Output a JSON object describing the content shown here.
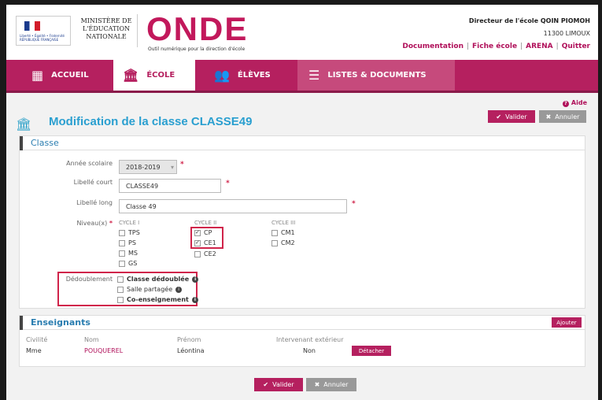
{
  "header": {
    "marianne_text": "Liberté • Égalité • Fraternité RÉPUBLIQUE FRANÇAISE",
    "ministere": "MINISTÈRE DE L'ÉDUCATION NATIONALE",
    "app_name": "ONDE",
    "app_subtitle": "Outil numérique pour la direction d'école",
    "user_name": "Directeur de l'école QOIN PIOMOH",
    "user_ecole": "11300 LIMOUX",
    "links": [
      "Documentation",
      "Fiche école",
      "ARENA",
      "Quitter"
    ]
  },
  "nav": {
    "items": [
      {
        "label": "ACCUEIL",
        "icon": "grid-icon"
      },
      {
        "label": "ÉCOLE",
        "icon": "school-icon"
      },
      {
        "label": "ÉLÈVES",
        "icon": "students-icon"
      },
      {
        "label": "LISTES & DOCUMENTS",
        "icon": "list-icon"
      }
    ]
  },
  "page": {
    "aide": "Aide",
    "title": "Modification de la classe CLASSE49",
    "valider": "Valider",
    "annuler": "Annuler"
  },
  "classe": {
    "section_title": "Classe",
    "annee_label": "Année scolaire",
    "annee_value": "2018-2019",
    "libelle_court_label": "Libellé court",
    "libelle_court_value": "CLASSE49",
    "libelle_long_label": "Libellé long",
    "libelle_long_value": "Classe 49",
    "niveaux_label": "Niveau(x)",
    "cycles": [
      {
        "name": "CYCLE I",
        "levels": [
          {
            "label": "TPS",
            "checked": false
          },
          {
            "label": "PS",
            "checked": false
          },
          {
            "label": "MS",
            "checked": false
          },
          {
            "label": "GS",
            "checked": false
          }
        ]
      },
      {
        "name": "CYCLE II",
        "levels": [
          {
            "label": "CP",
            "checked": true
          },
          {
            "label": "CE1",
            "checked": true
          },
          {
            "label": "CE2",
            "checked": false
          }
        ]
      },
      {
        "name": "CYCLE III",
        "levels": [
          {
            "label": "CM1",
            "checked": false
          },
          {
            "label": "CM2",
            "checked": false
          }
        ]
      }
    ],
    "dedoublement_label": "Dédoublement",
    "dedoublement_options": [
      {
        "label": "Classe dédoublée",
        "checked": false
      },
      {
        "label": "Salle partagée",
        "checked": false
      },
      {
        "label": "Co-enseignement",
        "checked": false
      }
    ]
  },
  "enseignants": {
    "section_title": "Enseignants",
    "ajouter": "Ajouter",
    "columns": [
      "Civilité",
      "Nom",
      "Prénom",
      "Intervenant extérieur"
    ],
    "rows": [
      {
        "civilite": "Mme",
        "nom": "POUQUEREL",
        "prenom": "Léontina",
        "intervenant": "Non",
        "action": "Détacher"
      }
    ]
  },
  "colors": {
    "brand": "#b5205f",
    "title": "#2a9fd0",
    "required": "#d0234a"
  }
}
